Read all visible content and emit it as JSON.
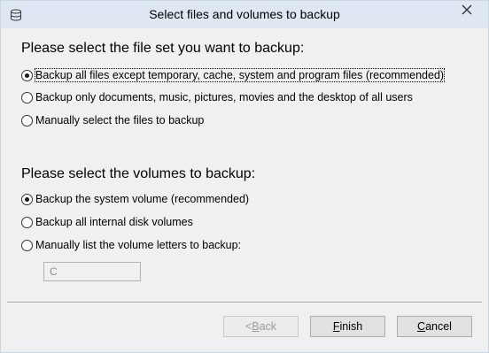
{
  "window": {
    "title": "Select files and volumes to backup"
  },
  "fileset": {
    "heading": "Please select the file set you want to backup:",
    "options": [
      {
        "label": "Backup all files except temporary, cache, system and program files (recommended)",
        "selected": true
      },
      {
        "label": "Backup only documents, music, pictures, movies and the desktop of all users",
        "selected": false
      },
      {
        "label": "Manually select the files to backup",
        "selected": false
      }
    ]
  },
  "volumes": {
    "heading": "Please select the volumes to backup:",
    "options": [
      {
        "label": "Backup the system volume (recommended)",
        "selected": true
      },
      {
        "label": "Backup all internal disk volumes",
        "selected": false
      },
      {
        "label": "Manually list the volume letters to backup:",
        "selected": false
      }
    ],
    "letters_value": "C"
  },
  "buttons": {
    "back_arrow": "< ",
    "back_mnemonic": "B",
    "back_rest": "ack",
    "finish_mnemonic": "F",
    "finish_rest": "inish",
    "cancel_mnemonic": "C",
    "cancel_rest": "ancel"
  }
}
